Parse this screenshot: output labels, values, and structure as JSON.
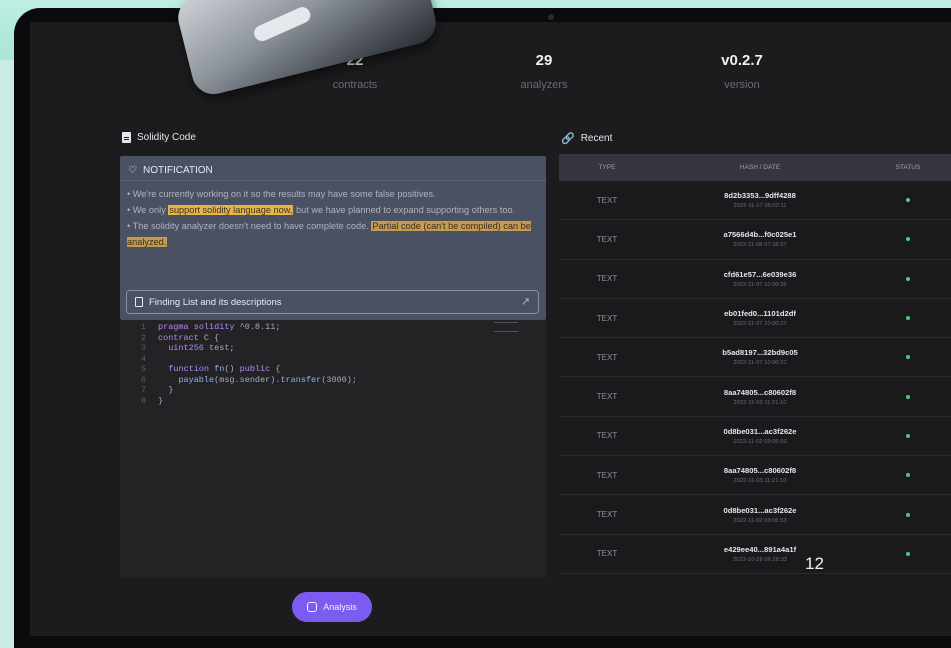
{
  "stats": [
    {
      "value": "22",
      "label": "contracts"
    },
    {
      "value": "29",
      "label": "analyzers"
    },
    {
      "value": "v0.2.7",
      "label": "version"
    }
  ],
  "sections": {
    "solidity_title": "Solidity Code",
    "recent_title": "Recent"
  },
  "notification": {
    "title": "NOTIFICATION",
    "line1": "• We're currently working on it so the results may have some false positives.",
    "line2_pre": "• We only ",
    "line2_hl": "support solidity language now,",
    "line2_post": " but we have planned to expand supporting others too.",
    "line3_pre": "• The solidity analyzer doesn't need to have complete code. ",
    "line3_hl": "Partial code (can't be compiled) can be analyzed.",
    "finding_button": "Finding List and its descriptions"
  },
  "code_lines": [
    {
      "n": "1",
      "text": "pragma solidity ^0.8.11;"
    },
    {
      "n": "2",
      "text": "contract C {"
    },
    {
      "n": "3",
      "text": "  uint256 test;"
    },
    {
      "n": "4",
      "text": ""
    },
    {
      "n": "5",
      "text": "  function fn() public {"
    },
    {
      "n": "6",
      "text": "    payable(msg.sender).transfer(3000);"
    },
    {
      "n": "7",
      "text": "  }"
    },
    {
      "n": "8",
      "text": "}"
    }
  ],
  "analysis_button": "Analysis",
  "table": {
    "headers": [
      "TYPE",
      "HASH / DATE",
      "STATUS"
    ],
    "rows": [
      {
        "type": "TEXT",
        "hash": "8d2b3353...9dff4288",
        "date": "2022-11-17 06:02:11"
      },
      {
        "type": "TEXT",
        "hash": "a7566d4b...f0c025e1",
        "date": "2022-11-08 07:38:37"
      },
      {
        "type": "TEXT",
        "hash": "cfd61e57...6e039e36",
        "date": "2022-11-07 10:00:36"
      },
      {
        "type": "TEXT",
        "hash": "eb01fed0...1101d2df",
        "date": "2022-11-07 10:00:27"
      },
      {
        "type": "TEXT",
        "hash": "b5ad8197...32bd9c05",
        "date": "2022-11-07 10:00:21"
      },
      {
        "type": "TEXT",
        "hash": "8aa74805...c80602f8",
        "date": "2022-11-03 11:21:10"
      },
      {
        "type": "TEXT",
        "hash": "0d8be031...ac3f262e",
        "date": "2022-11-02 03:06:53"
      },
      {
        "type": "TEXT",
        "hash": "8aa74805...c80602f8",
        "date": "2022-11-03 11:21:10"
      },
      {
        "type": "TEXT",
        "hash": "0d8be031...ac3f262e",
        "date": "2022-11-02 03:06:53"
      },
      {
        "type": "TEXT",
        "hash": "e429ee40...891a4a1f",
        "date": "2022-10-28 06:28:33"
      }
    ]
  },
  "page_number": "12",
  "colors": {
    "accent": "#7c5cf0",
    "status_ok": "#41d27a",
    "notif_bg": "#4a5163"
  }
}
